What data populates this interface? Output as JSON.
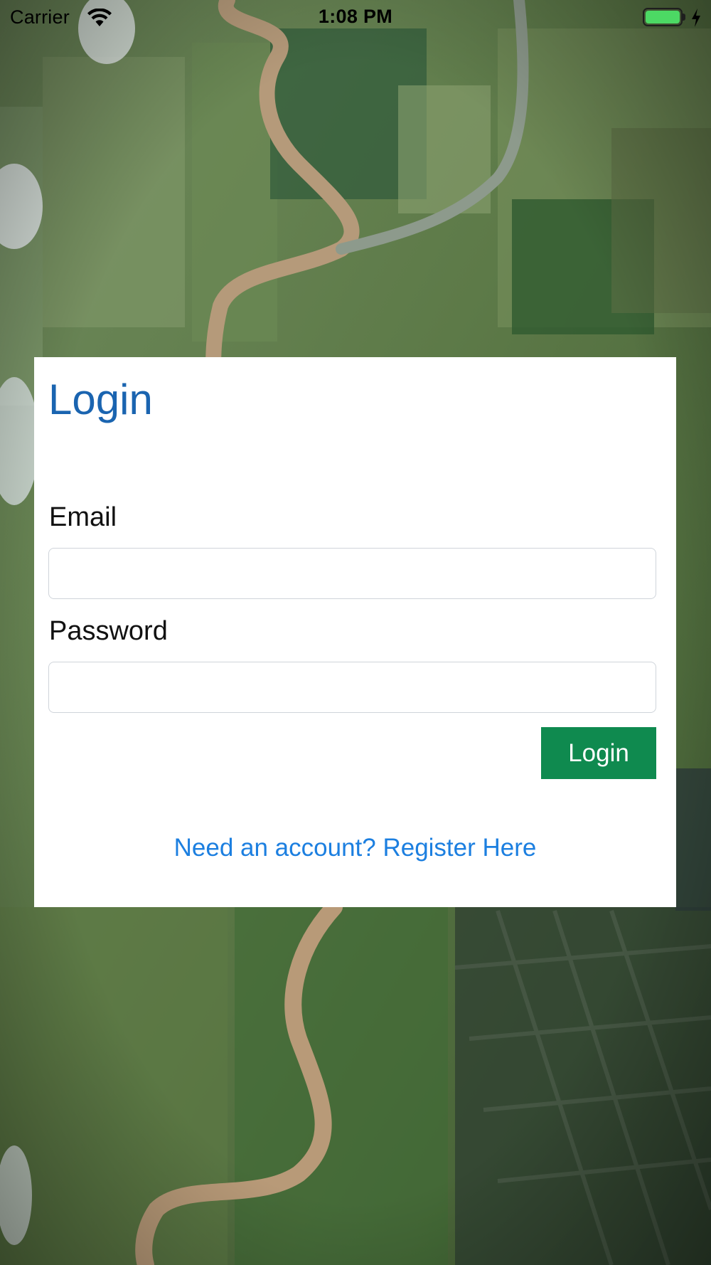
{
  "status_bar": {
    "carrier": "Carrier",
    "time": "1:08 PM",
    "wifi_icon": "wifi-icon",
    "battery_icon": "battery-icon",
    "charging_icon": "charging-bolt-icon",
    "battery_level": 1.0,
    "battery_color": "#4cd964"
  },
  "background": {
    "description_icon": "aerial-river-landscape-image"
  },
  "login_card": {
    "title": "Login",
    "email_label": "Email",
    "email_value": "",
    "email_placeholder": "",
    "password_label": "Password",
    "password_value": "",
    "password_placeholder": "",
    "login_button_label": "Login",
    "register_link": "Need an account? Register Here",
    "colors": {
      "title": "#1a64b0",
      "button": "#0f8a4f",
      "link": "#1c7fe0"
    }
  }
}
